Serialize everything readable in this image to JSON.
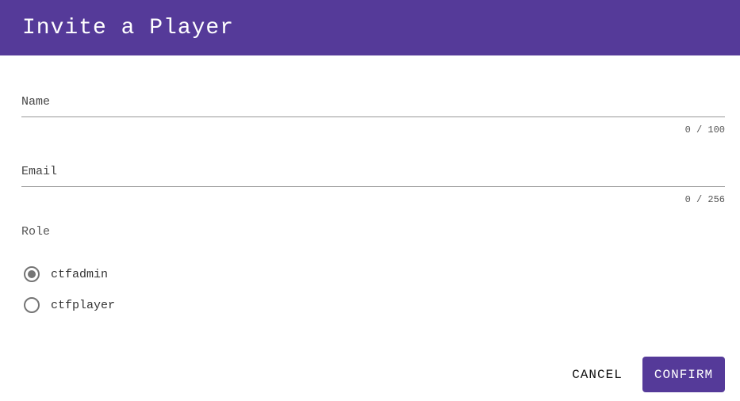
{
  "dialog": {
    "title": "Invite a Player"
  },
  "fields": [
    {
      "label": "Name",
      "value": "",
      "counter": "0 / 100"
    },
    {
      "label": "Email",
      "value": "",
      "counter": "0 / 256"
    }
  ],
  "role": {
    "label": "Role",
    "options": [
      {
        "label": "ctfadmin",
        "selected": true
      },
      {
        "label": "ctfplayer",
        "selected": false
      }
    ]
  },
  "actions": {
    "cancel": "CANCEL",
    "confirm": "CONFIRM"
  },
  "colors": {
    "accent": "#553a99"
  }
}
